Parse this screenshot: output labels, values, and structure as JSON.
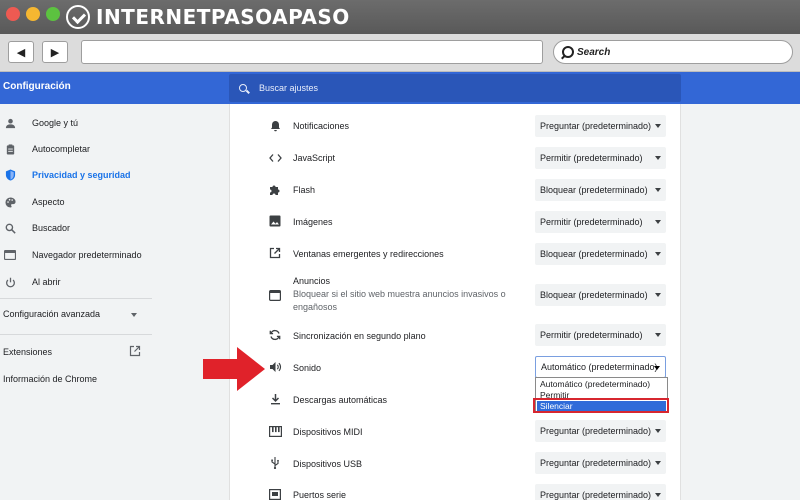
{
  "brand": {
    "logo_text": "INTERNETPASOAPASO"
  },
  "browser": {
    "search_label": "Search"
  },
  "header": {
    "title": "Configuración",
    "search_placeholder": "Buscar ajustes"
  },
  "sidebar": {
    "items": [
      {
        "label": "Google y tú",
        "icon": "person-icon"
      },
      {
        "label": "Autocompletar",
        "icon": "clipboard-icon"
      },
      {
        "label": "Privacidad y seguridad",
        "icon": "shield-icon",
        "active": true
      },
      {
        "label": "Aspecto",
        "icon": "palette-icon"
      },
      {
        "label": "Buscador",
        "icon": "search-icon"
      },
      {
        "label": "Navegador predeterminado",
        "icon": "browser-icon"
      },
      {
        "label": "Al abrir",
        "icon": "power-icon"
      }
    ],
    "advanced": "Configuración avanzada",
    "extensions": "Extensiones",
    "about": "Información de Chrome"
  },
  "rows": [
    {
      "label": "Notificaciones",
      "value": "Preguntar (predeterminado)",
      "icon": "bell-icon"
    },
    {
      "label": "JavaScript",
      "value": "Permitir (predeterminado)",
      "icon": "code-icon"
    },
    {
      "label": "Flash",
      "value": "Bloquear (predeterminado)",
      "icon": "puzzle-icon"
    },
    {
      "label": "Imágenes",
      "value": "Permitir (predeterminado)",
      "icon": "image-icon"
    },
    {
      "label": "Ventanas emergentes y redirecciones",
      "value": "Bloquear (predeterminado)",
      "icon": "external-link-icon"
    },
    {
      "label": "Anuncios",
      "sublabel": "Bloquear si el sitio web muestra anuncios invasivos o engañosos",
      "value": "Bloquear (predeterminado)",
      "icon": "ads-icon"
    },
    {
      "label": "Sincronización en segundo plano",
      "value": "Permitir (predeterminado)",
      "icon": "sync-icon"
    },
    {
      "label": "Sonido",
      "value": "Automático (predeterminado)",
      "icon": "speaker-icon",
      "open": true
    },
    {
      "label": "Descargas automáticas",
      "value": "",
      "icon": "download-icon"
    },
    {
      "label": "Dispositivos MIDI",
      "value": "Preguntar (predeterminado)",
      "icon": "piano-icon"
    },
    {
      "label": "Dispositivos USB",
      "value": "Preguntar (predeterminado)",
      "icon": "usb-icon"
    },
    {
      "label": "Puertos serie",
      "value": "Preguntar (predeterminado)",
      "icon": "serial-port-icon"
    }
  ],
  "sound_dropdown": {
    "options": [
      "Automático (predeterminado)",
      "Permitir",
      "Silenciar"
    ],
    "highlighted": "Silenciar"
  },
  "colors": {
    "header": "#3367d6",
    "accent": "#1a73e8",
    "highlight_box": "#d7262f",
    "arrow": "#e0222a"
  }
}
